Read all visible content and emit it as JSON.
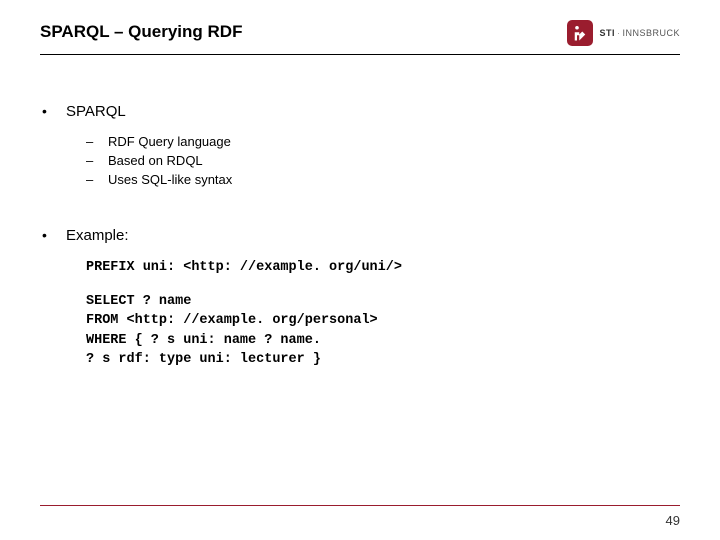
{
  "header": {
    "title": "SPARQL – Querying RDF",
    "logo": {
      "sti": "STI",
      "sep": "·",
      "name": "INNSBRUCK"
    }
  },
  "section1": {
    "heading": "SPARQL",
    "items": [
      "RDF Query language",
      "Based on RDQL",
      "Uses SQL-like syntax"
    ]
  },
  "section2": {
    "heading": "Example:",
    "code": [
      "PREFIX uni: <http: //example. org/uni/>",
      "",
      "SELECT ? name",
      "FROM <http: //example. org/personal>",
      "WHERE { ? s uni: name ? name.",
      "? s rdf: type uni: lecturer }"
    ]
  },
  "page_number": "49"
}
